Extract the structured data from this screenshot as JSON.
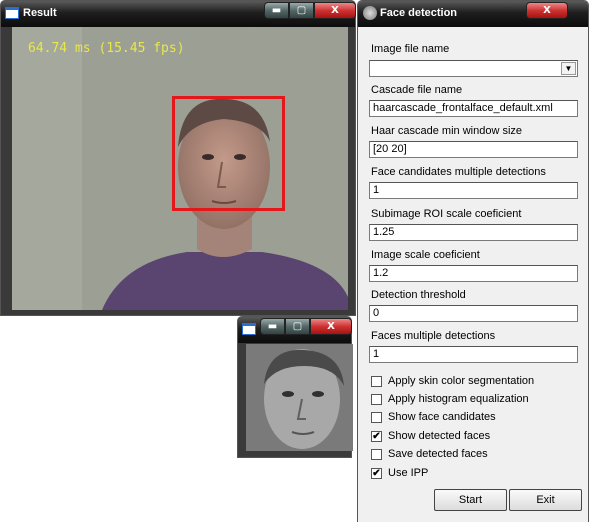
{
  "result_window": {
    "title": "Result",
    "fps_text": "64.74 ms (15.45 fps)",
    "controls": {
      "minimize": "▬",
      "maximize": "▢",
      "close": "X"
    }
  },
  "thumb_window": {
    "controls": {
      "minimize": "▬",
      "maximize": "▢",
      "close": "X"
    }
  },
  "face_window": {
    "title": "Face detection",
    "controls": {
      "close": "X"
    },
    "fields": {
      "image_file_label": "Image file name",
      "image_file_value": "",
      "cascade_label": "Cascade file name",
      "cascade_value": "haarcascade_frontalface_default.xml",
      "min_window_label": "Haar cascade min window size",
      "min_window_value": "[20 20]",
      "candidates_label": "Face candidates multiple detections",
      "candidates_value": "1",
      "roi_label": "Subimage ROI scale coeficient",
      "roi_value": "1.25",
      "scale_label": "Image scale coeficient",
      "scale_value": "1.2",
      "threshold_label": "Detection threshold",
      "threshold_value": "0",
      "faces_label": "Faces multiple detections",
      "faces_value": "1"
    },
    "checkboxes": [
      {
        "label": "Apply skin color segmentation",
        "checked": false
      },
      {
        "label": "Apply histogram equalization",
        "checked": false
      },
      {
        "label": "Show face candidates",
        "checked": false
      },
      {
        "label": "Show detected faces",
        "checked": true
      },
      {
        "label": "Save detected faces",
        "checked": false
      },
      {
        "label": "Use IPP",
        "checked": true
      }
    ],
    "buttons": {
      "start": "Start",
      "exit": "Exit"
    }
  }
}
